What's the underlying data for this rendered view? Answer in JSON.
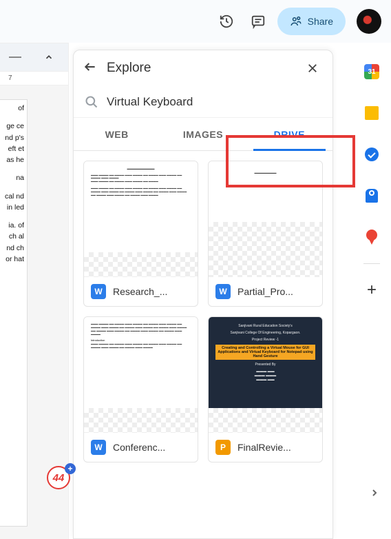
{
  "topbar": {
    "share_label": "Share"
  },
  "explore": {
    "title": "Explore",
    "search_value": "Virtual Keyboard",
    "tabs": {
      "web": "WEB",
      "images": "IMAGES",
      "drive": "DRIVE"
    },
    "results": [
      {
        "name": "Research_...",
        "icon": "W",
        "icon_type": "word"
      },
      {
        "name": "Partial_Pro...",
        "icon": "W",
        "icon_type": "word"
      },
      {
        "name": "Conferenc...",
        "icon": "W",
        "icon_type": "word"
      },
      {
        "name": "FinalRevie...",
        "icon": "P",
        "icon_type": "slides"
      }
    ],
    "slide_preview": {
      "line1": "Sanjivani Rural Education Society's",
      "line2": "Sanjivani College Of Engineering, Kopargaon.",
      "line3": "Project Review -1",
      "highlight": "Creating and Controlling a Virtual Mouse for GUI Applications and Virtual Keyboard for Notepad using Hand Gesture",
      "presented": "Presented By"
    }
  },
  "ruler": {
    "mark": "7"
  },
  "doc_fragments": {
    "p1": "of",
    "p2": "ge ce nd p's eft et as he",
    "p3": "na",
    "p4": "cal nd in led",
    "p5": "ia. of ch al nd ch or hat"
  },
  "badge": {
    "count": "44",
    "plus": "+"
  },
  "rail": {
    "calendar_day": "31"
  }
}
